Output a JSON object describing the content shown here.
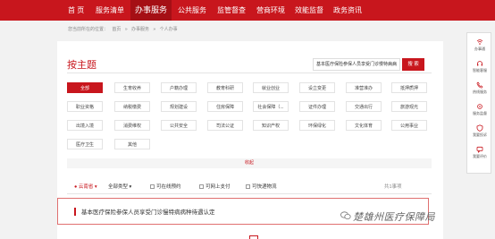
{
  "nav": {
    "items": [
      "首 页",
      "服务清单",
      "办事服务",
      "公共服务",
      "监管督查",
      "营商环境",
      "效能监督",
      "政务资讯"
    ],
    "active_index": 2
  },
  "breadcrumb": [
    "您当前所在的位置：",
    "首页",
    "»",
    "办事服务",
    "»",
    "个人办事"
  ],
  "theme": {
    "title": "按主题",
    "search_value": "基本医疗保险参保人员享受门诊慢特病病",
    "search_button": "搜 索",
    "chips": [
      [
        "全部",
        "生育收养",
        "户籍办理",
        "教育科研",
        "就业创业",
        "设立变更",
        "准营准办",
        "抵押质押"
      ],
      [
        "职业资格",
        "纳税缴费",
        "规划建设",
        "住房保障",
        "社会保障（...",
        "证件办理",
        "交通出行",
        "旅游观光"
      ],
      [
        "出境入境",
        "消费维权",
        "公共安全",
        "司法公证",
        "知识产权",
        "环保绿化",
        "文化体育",
        "公用事业"
      ],
      [
        "医疗卫生",
        "其他"
      ]
    ],
    "active_chip": "全部",
    "collapse_label": "收起"
  },
  "filters": {
    "location": "云南省",
    "type": "全部类型",
    "online_booking": "可在线预约",
    "online_payment": "可网上支付",
    "express": "可快递物流",
    "total": "共1事项"
  },
  "result": {
    "title": "基本医疗保险参保人员享受门诊慢特病病种待遇认定"
  },
  "side_toolbar": [
    {
      "icon": "wifi-icon",
      "label": "办事通"
    },
    {
      "icon": "headset-icon",
      "label": "智能客服"
    },
    {
      "icon": "phone-icon",
      "label": "热线服务"
    },
    {
      "icon": "gear-icon",
      "label": "服务监督"
    },
    {
      "icon": "shield-icon",
      "label": "我要投诉"
    },
    {
      "icon": "chat-icon",
      "label": "我要评价"
    }
  ],
  "watermark": "楚雄州医疗保障局",
  "colors": {
    "brand": "#c8161d",
    "brand_dark": "#a50f15"
  }
}
